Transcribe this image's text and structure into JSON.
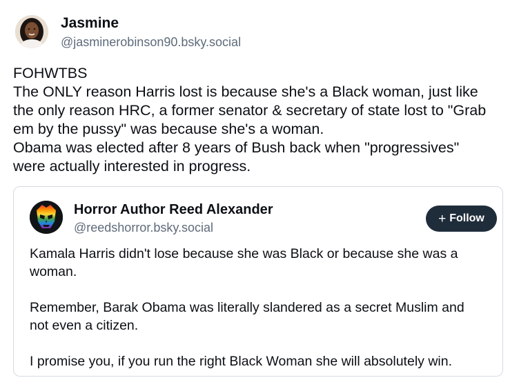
{
  "post": {
    "author": {
      "name": "Jasmine",
      "handle": "@jasminerobinson90.bsky.social",
      "avatar_icon": "user-avatar-photo"
    },
    "text_lines": [
      "FOHWTBS",
      "The ONLY reason Harris lost is because she's a Black woman, just like",
      "the only reason HRC, a former senator & secretary of state lost to \"Grab",
      "em by the pussy\" was because she's a woman.",
      "Obama was elected after 8 years of Bush back when \"progressives\"",
      "were actually interested in progress."
    ]
  },
  "quoted_post": {
    "author": {
      "name": "Horror Author Reed Alexander",
      "handle": "@reedshorror.bsky.social",
      "avatar_icon": "rainbow-skull-mask-avatar"
    },
    "follow_button": {
      "icon": "+",
      "label": "Follow"
    },
    "paragraphs": [
      [
        "Kamala Harris didn't lose because she was Black or because she was a",
        "woman."
      ],
      [
        "Remember, Barak Obama was literally slandered as a secret Muslim and",
        "not even a citizen."
      ],
      [
        "I promise you, if you run the right Black Woman she will absolutely win."
      ]
    ],
    "colors": {
      "follow_bg": "#1f2d3b",
      "handle_text": "#5e6b7a",
      "border": "#d4dbe2"
    }
  }
}
